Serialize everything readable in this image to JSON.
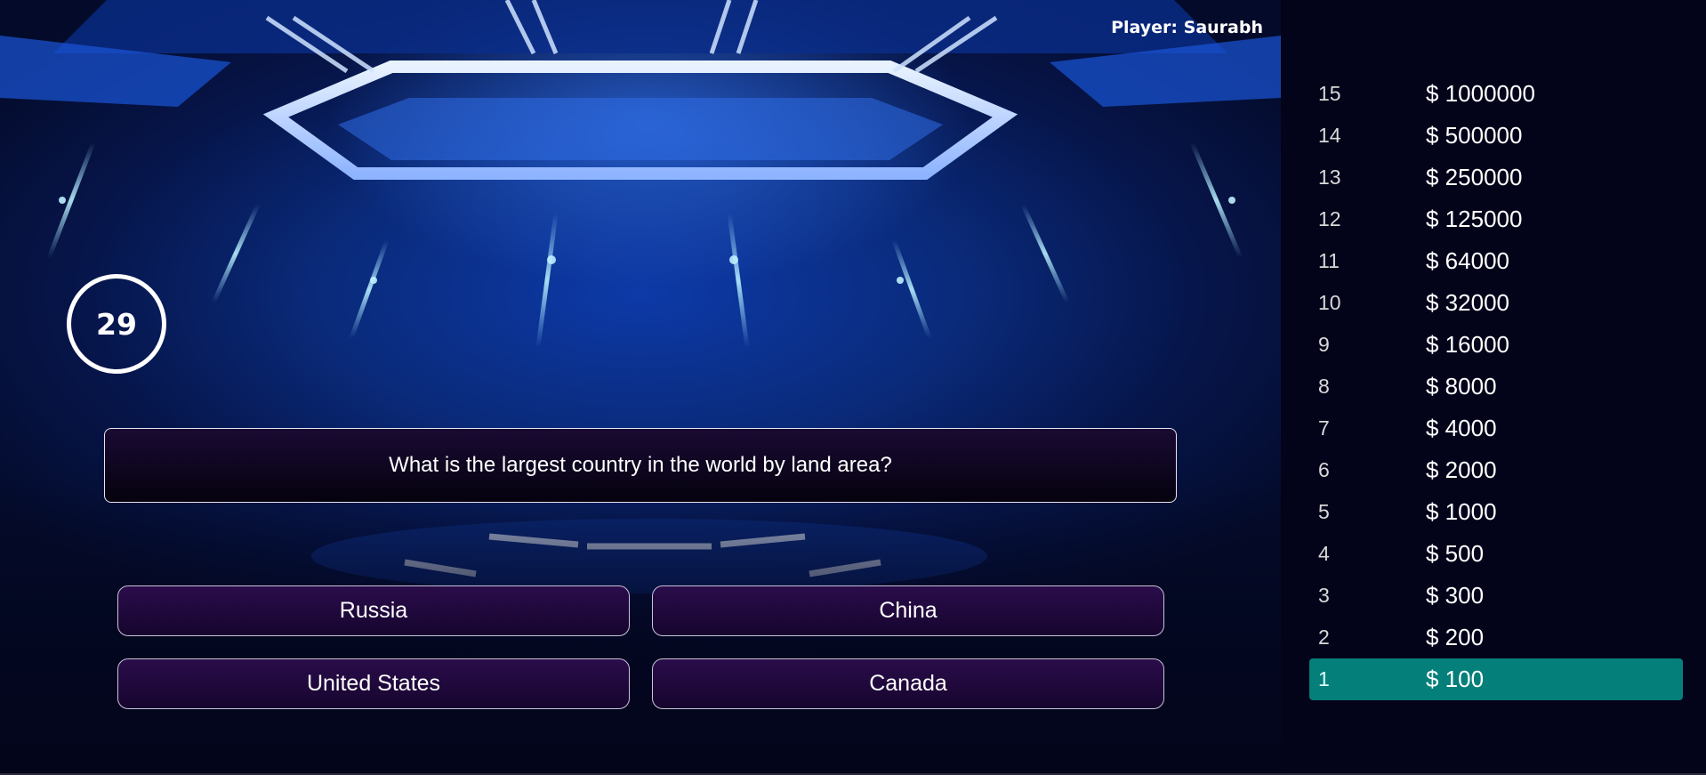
{
  "player": {
    "label": "Player: Saurabh"
  },
  "timer": {
    "seconds": "29"
  },
  "question": {
    "text": "What is the largest country in the world by land area?"
  },
  "answers": [
    {
      "label": "Russia"
    },
    {
      "label": "China"
    },
    {
      "label": "United States"
    },
    {
      "label": "Canada"
    }
  ],
  "ladder": {
    "current_level": 1,
    "highlight_color": "#057f7a",
    "levels": [
      {
        "num": "15",
        "amount": "$ 1000000"
      },
      {
        "num": "14",
        "amount": "$ 500000"
      },
      {
        "num": "13",
        "amount": "$ 250000"
      },
      {
        "num": "12",
        "amount": "$ 125000"
      },
      {
        "num": "11",
        "amount": "$ 64000"
      },
      {
        "num": "10",
        "amount": "$ 32000"
      },
      {
        "num": "9",
        "amount": "$ 16000"
      },
      {
        "num": "8",
        "amount": "$ 8000"
      },
      {
        "num": "7",
        "amount": "$ 4000"
      },
      {
        "num": "6",
        "amount": "$ 2000"
      },
      {
        "num": "5",
        "amount": "$ 1000"
      },
      {
        "num": "4",
        "amount": "$ 500"
      },
      {
        "num": "3",
        "amount": "$ 300"
      },
      {
        "num": "2",
        "amount": "$ 200"
      },
      {
        "num": "1",
        "amount": "$ 100"
      }
    ]
  }
}
